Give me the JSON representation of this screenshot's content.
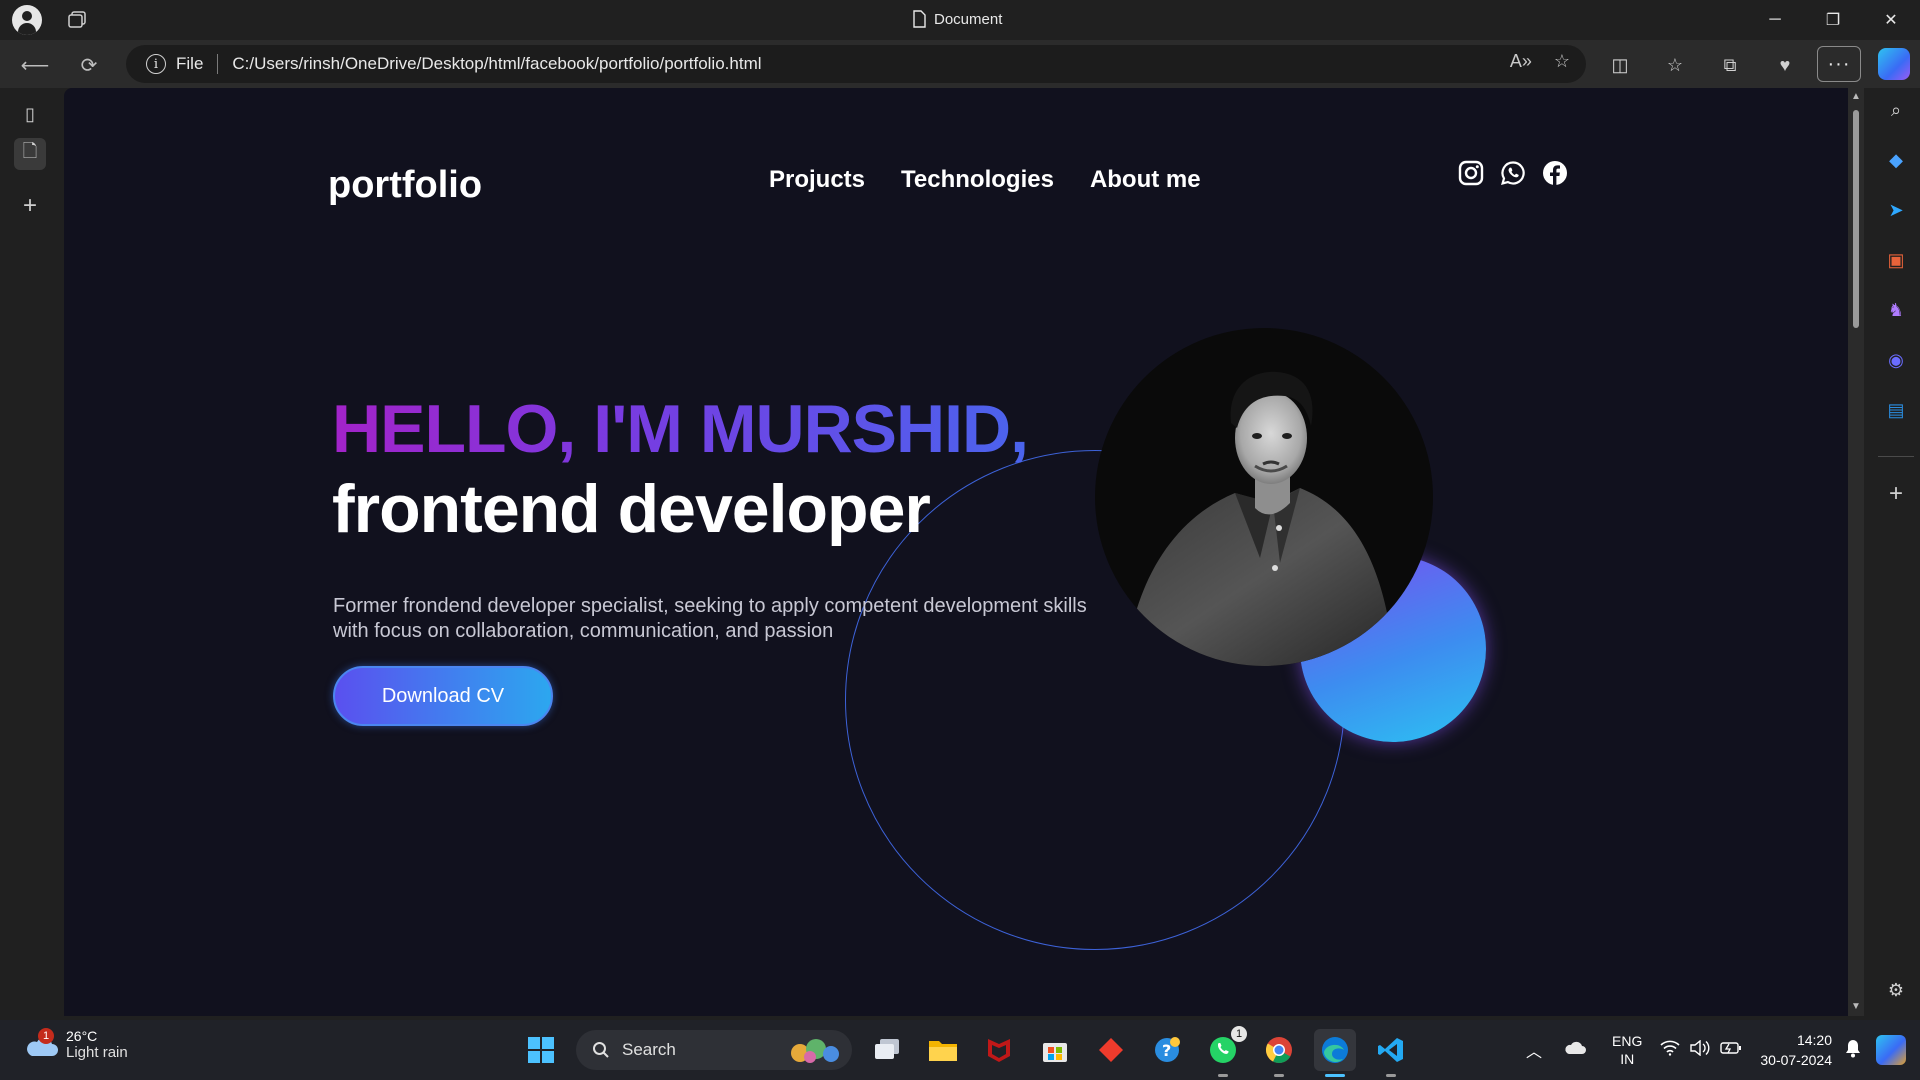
{
  "browser": {
    "tab_title": "Document",
    "url_scheme": "File",
    "url": "C:/Users/rinsh/OneDrive/Desktop/html/facebook/portfolio/portfolio.html",
    "more_label": "···"
  },
  "page": {
    "logo": "portfolio",
    "nav": [
      "Projucts",
      "Technologies",
      "About me"
    ],
    "social_icons": [
      "instagram-icon",
      "whatsapp-icon",
      "facebook-icon"
    ],
    "hero": {
      "greeting": "HELLO, I'M MURSHID,",
      "role": "frontend developer",
      "description": "Former frondend developer specialist, seeking to apply competent development skills with focus on collaboration, communication, and passion",
      "cta": "Download CV"
    },
    "colors": {
      "background": "#11111e",
      "greeting_gradient_start": "#a323c9",
      "greeting_gradient_end": "#4a64ec",
      "button_gradient_start": "#5a50ef",
      "button_gradient_end": "#2ca7ef",
      "ring": "#3d62d8"
    }
  },
  "taskbar": {
    "weather_temp": "26°C",
    "weather_desc": "Light rain",
    "weather_badge": "1",
    "search_placeholder": "Search",
    "whatsapp_badge": "1",
    "lang_line1": "ENG",
    "lang_line2": "IN",
    "time": "14:20",
    "date": "30-07-2024"
  }
}
